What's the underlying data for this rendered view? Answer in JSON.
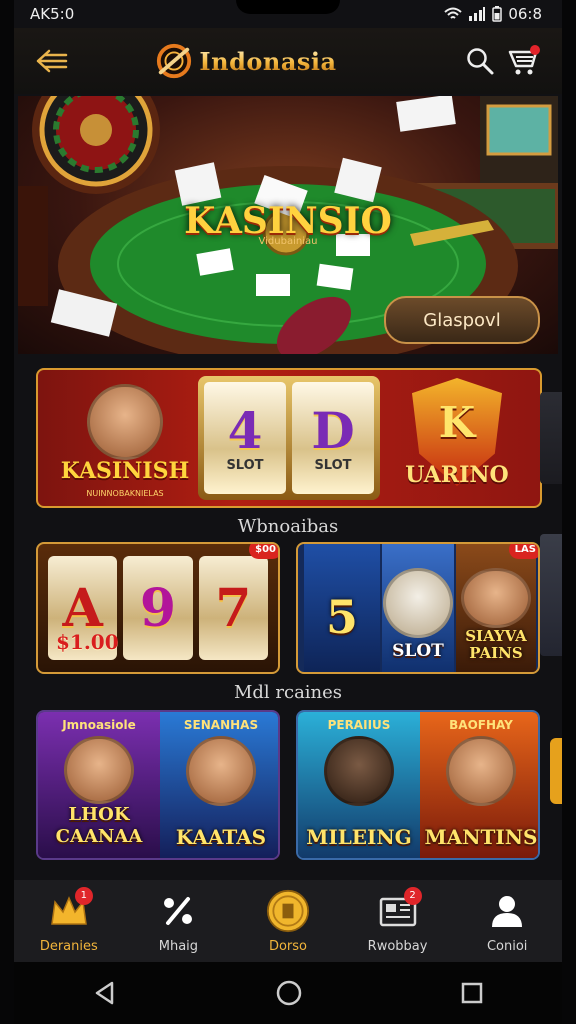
{
  "status_bar": {
    "time": "AK5:0",
    "clock": "06:8"
  },
  "header": {
    "title": "Indonasia"
  },
  "hero": {
    "title": "KASINSIO",
    "subtitle": "Vidubainiau",
    "cta_label": "Glaspovl"
  },
  "banner": {
    "left_label": "KASINISH",
    "left_sub": "NUINNOBAKNIELAS",
    "reels": [
      {
        "symbol": "4",
        "label": "SLOT"
      },
      {
        "symbol": "D",
        "label": "SLOT"
      }
    ],
    "shield_letter": "K",
    "right_label": "UARINO"
  },
  "sections": [
    "Wbnoaibas",
    "Mdl rcaines"
  ],
  "slot_games": [
    {
      "reels": [
        "A",
        "9",
        "7"
      ],
      "caption": "$1.00",
      "badge": "$00"
    },
    {
      "tiles": [
        {
          "title": "5",
          "sub": ""
        },
        {
          "title": "SLOT",
          "sub": ""
        },
        {
          "title": "SIAYVA PAINS",
          "sub": ""
        }
      ],
      "badge": "LAS"
    }
  ],
  "promo_games": [
    {
      "tiles": [
        {
          "title": "LHOK CAANAA",
          "top": "Jmnoasiole"
        },
        {
          "title": "KAATAS",
          "top": "SENANHAS"
        }
      ]
    },
    {
      "tiles": [
        {
          "title": "MILEING",
          "top": "PERAIIUS"
        },
        {
          "title": "MANTINS",
          "top": "BAOFHAY"
        }
      ]
    }
  ],
  "bottom_nav": [
    {
      "label": "Deranies",
      "icon": "crown-icon",
      "badge": "1",
      "active": true
    },
    {
      "label": "Mhaig",
      "icon": "percent-icon",
      "badge": "",
      "active": false
    },
    {
      "label": "Dorso",
      "icon": "coin-icon",
      "badge": "",
      "active": true
    },
    {
      "label": "Rwobbay",
      "icon": "wallet-icon",
      "badge": "2",
      "active": false
    },
    {
      "label": "Conioi",
      "icon": "user-icon",
      "badge": "",
      "active": false
    }
  ]
}
